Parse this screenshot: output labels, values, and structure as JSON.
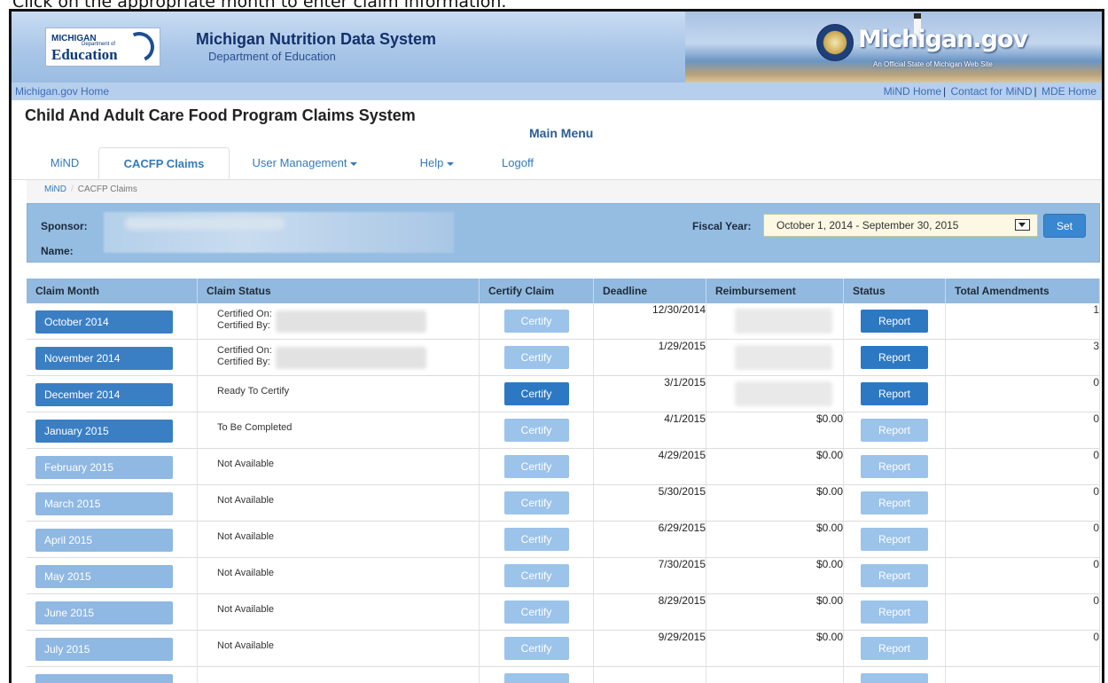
{
  "instruction": "Click on the appropriate month to enter claim information.",
  "banner": {
    "logo_line1": "MICHIGAN",
    "logo_line2": "Department of",
    "logo_line3": "Education",
    "system_title": "Michigan Nutrition Data System",
    "system_subtitle": "Department of Education",
    "state_site": "Michigan.gov",
    "state_tagline": "An Official State of Michigan Web Site"
  },
  "linkbar": {
    "left_link": "Michigan.gov Home",
    "right_links": [
      "MiND Home",
      "Contact for MiND",
      "MDE Home"
    ],
    "separator": "|"
  },
  "app_title": "Child And Adult Care Food Program Claims System",
  "main_menu": "Main Menu",
  "tabs": [
    {
      "label": "MiND"
    },
    {
      "label": "CACFP Claims",
      "active": true
    },
    {
      "label": "User Management",
      "dropdown": true
    },
    {
      "label": "Help",
      "dropdown": true
    },
    {
      "label": "Logoff"
    }
  ],
  "breadcrumb": {
    "items": [
      "MiND",
      "CACFP Claims"
    ],
    "separator": "/"
  },
  "sponsor": {
    "sponsor_label": "Sponsor:",
    "name_label": "Name:",
    "fiscal_year_label": "Fiscal Year:",
    "fiscal_year_value": "October 1, 2014 - September 30, 2015",
    "set_button": "Set"
  },
  "table": {
    "headers": [
      "Claim Month",
      "Claim Status",
      "Certify Claim",
      "Deadline",
      "Reimbursement",
      "Status",
      "Total Amendments"
    ],
    "certify_label": "Certify",
    "report_label": "Report",
    "certified_on_label": "Certified On:",
    "certified_by_label": "Certified By:",
    "rows": [
      {
        "month": "October 2014",
        "status": "certified",
        "deadline": "12/30/2014",
        "reimbursement": "",
        "amendments": "1"
      },
      {
        "month": "November 2014",
        "status": "certified",
        "deadline": "1/29/2015",
        "reimbursement": "",
        "amendments": "3"
      },
      {
        "month": "December 2014",
        "status": "Ready To Certify",
        "deadline": "3/1/2015",
        "reimbursement": "",
        "amendments": "0"
      },
      {
        "month": "January 2015",
        "status": "To Be Completed",
        "deadline": "4/1/2015",
        "reimbursement": "$0.00",
        "amendments": "0"
      },
      {
        "month": "February 2015",
        "status": "Not Available",
        "deadline": "4/29/2015",
        "reimbursement": "$0.00",
        "amendments": "0"
      },
      {
        "month": "March 2015",
        "status": "Not Available",
        "deadline": "5/30/2015",
        "reimbursement": "$0.00",
        "amendments": "0"
      },
      {
        "month": "April 2015",
        "status": "Not Available",
        "deadline": "6/29/2015",
        "reimbursement": "$0.00",
        "amendments": "0"
      },
      {
        "month": "May 2015",
        "status": "Not Available",
        "deadline": "7/30/2015",
        "reimbursement": "$0.00",
        "amendments": "0"
      },
      {
        "month": "June 2015",
        "status": "Not Available",
        "deadline": "8/29/2015",
        "reimbursement": "$0.00",
        "amendments": "0"
      },
      {
        "month": "July 2015",
        "status": "Not Available",
        "deadline": "9/29/2015",
        "reimbursement": "$0.00",
        "amendments": "0"
      },
      {
        "month": "",
        "status": "",
        "deadline": "",
        "reimbursement": "",
        "amendments": ""
      }
    ]
  },
  "colors": {
    "active_button": "#3a7fc4",
    "disabled_button": "#8fb8e2",
    "header_bg": "#92b9df",
    "link": "#337ab7"
  }
}
